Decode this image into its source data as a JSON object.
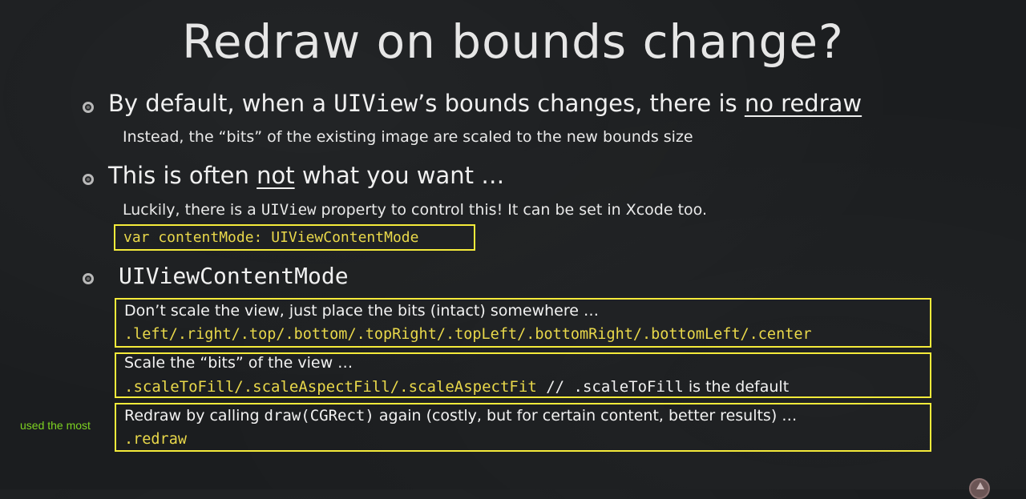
{
  "slide": {
    "title": "Redraw on bounds change?",
    "bullet1": {
      "text_a": "By default, when a ",
      "code": "UIView",
      "text_b": "’s ",
      "text_c": "bounds changes, there is ",
      "emphasis": "no redraw",
      "sub": "Instead, the “bits” of the existing image are scaled to the new bounds size"
    },
    "bullet2": {
      "text_a": "This is often ",
      "emphasis": "not",
      "text_b": " what you want …",
      "sub_a": "Luckily, there is a ",
      "sub_code": "UIView",
      "sub_b": " property to control this!  It can be set in Xcode too.",
      "code_box": "var contentMode: UIViewContentMode"
    },
    "bullet3": {
      "label": "UIViewContentMode"
    },
    "mode_boxes": [
      {
        "desc": "Don’t scale the view, just place the bits (intact) somewhere …",
        "code": ".left/.right/.top/.bottom/.topRight/.topLeft/.bottomRight/.bottomLeft/.center"
      },
      {
        "desc": "Scale the “bits” of the view …",
        "code": ".scaleToFill/.scaleAspectFill/.scaleAspectFit",
        "comment_a": " // ",
        "comment_code": ".scaleToFill",
        "comment_b": " is the default"
      },
      {
        "desc_a": "Redraw by calling ",
        "desc_code": "draw(CGRect)",
        "desc_b": " again (costly, but for certain content, better results) …",
        "code": ".redraw"
      }
    ],
    "annotation": "used the most"
  },
  "colors": {
    "background": "#1b1d1f",
    "highlight_box": "#f5eb3a",
    "code_yellow": "#e9d84a",
    "annotation_green": "#7ed321"
  },
  "icons": {
    "bullet": "bullet-dot-icon",
    "corner": "presenter-badge-icon"
  }
}
